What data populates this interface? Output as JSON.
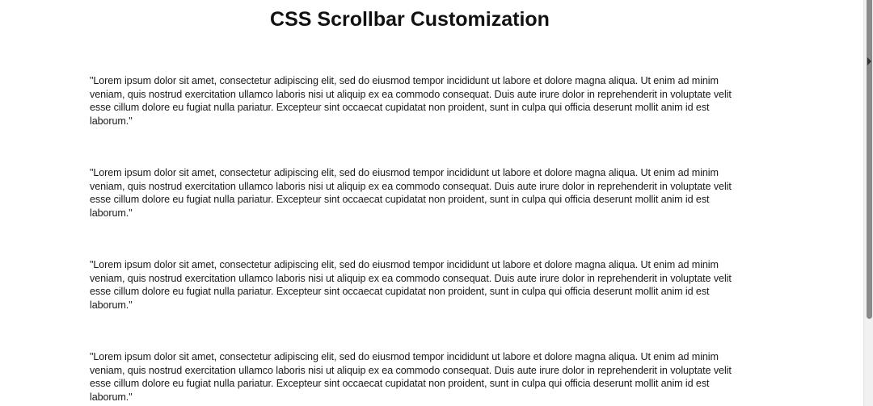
{
  "page": {
    "title": "CSS Scrollbar Customization"
  },
  "paragraphs": [
    "\"Lorem ipsum dolor sit amet, consectetur adipiscing elit, sed do eiusmod tempor incididunt ut labore et dolore magna aliqua. Ut enim ad minim veniam, quis nostrud exercitation ullamco laboris nisi ut aliquip ex ea commodo consequat. Duis aute irure dolor in reprehenderit in voluptate velit esse cillum dolore eu fugiat nulla pariatur. Excepteur sint occaecat cupidatat non proident, sunt in culpa qui officia deserunt mollit anim id est laborum.\"",
    "\"Lorem ipsum dolor sit amet, consectetur adipiscing elit, sed do eiusmod tempor incididunt ut labore et dolore magna aliqua. Ut enim ad minim veniam, quis nostrud exercitation ullamco laboris nisi ut aliquip ex ea commodo consequat. Duis aute irure dolor in reprehenderit in voluptate velit esse cillum dolore eu fugiat nulla pariatur. Excepteur sint occaecat cupidatat non proident, sunt in culpa qui officia deserunt mollit anim id est laborum.\"",
    "\"Lorem ipsum dolor sit amet, consectetur adipiscing elit, sed do eiusmod tempor incididunt ut labore et dolore magna aliqua. Ut enim ad minim veniam, quis nostrud exercitation ullamco laboris nisi ut aliquip ex ea commodo consequat. Duis aute irure dolor in reprehenderit in voluptate velit esse cillum dolore eu fugiat nulla pariatur. Excepteur sint occaecat cupidatat non proident, sunt in culpa qui officia deserunt mollit anim id est laborum.\"",
    "\"Lorem ipsum dolor sit amet, consectetur adipiscing elit, sed do eiusmod tempor incididunt ut labore et dolore magna aliqua. Ut enim ad minim veniam, quis nostrud exercitation ullamco laboris nisi ut aliquip ex ea commodo consequat. Duis aute irure dolor in reprehenderit in voluptate velit esse cillum dolore eu fugiat nulla pariatur. Excepteur sint occaecat cupidatat non proident, sunt in culpa qui officia deserunt mollit anim id est laborum.\""
  ],
  "scrollbar": {
    "position_fraction": 0.0,
    "thumb_color": "#8a8a8a",
    "track_color": "#f1f1f1"
  }
}
